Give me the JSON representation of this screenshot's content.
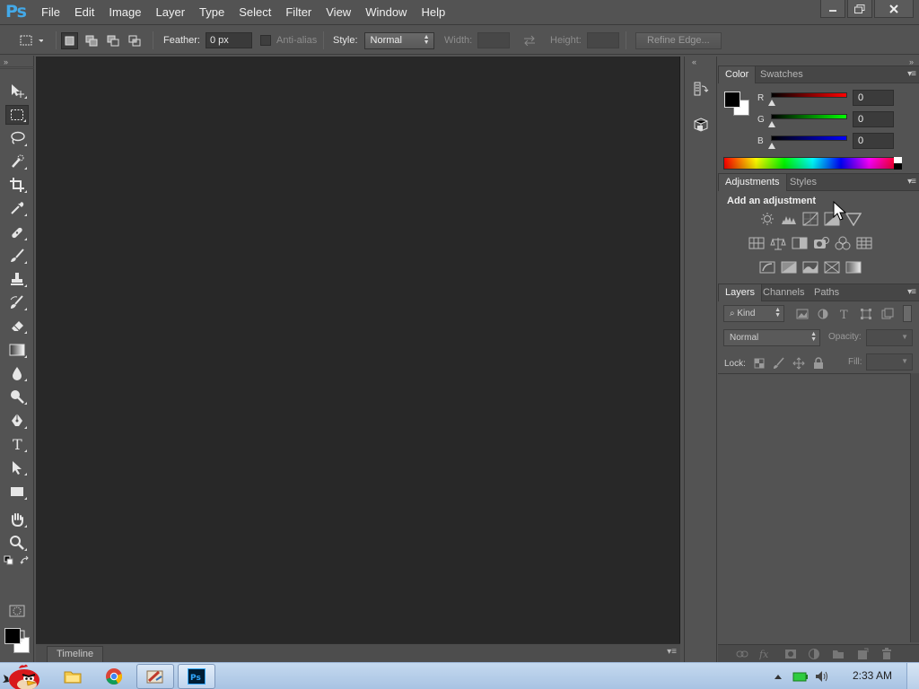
{
  "app": {
    "logo": "Ps"
  },
  "menu": [
    "File",
    "Edit",
    "Image",
    "Layer",
    "Type",
    "Select",
    "Filter",
    "View",
    "Window",
    "Help"
  ],
  "window_controls": {
    "minimize_icon": "minimize-icon",
    "restore_icon": "restore-icon",
    "close_icon": "close-icon"
  },
  "options": {
    "feather_label": "Feather:",
    "feather_value": "0 px",
    "antialias_label": "Anti-alias",
    "style_label": "Style:",
    "style_value": "Normal",
    "width_label": "Width:",
    "height_label": "Height:",
    "refine_edge_label": "Refine Edge..."
  },
  "tools": [
    "move-tool",
    "rectangular-marquee-tool",
    "lasso-tool",
    "quick-selection-tool",
    "crop-tool",
    "eyedropper-tool",
    "spot-healing-brush-tool",
    "brush-tool",
    "clone-stamp-tool",
    "history-brush-tool",
    "eraser-tool",
    "gradient-tool",
    "blur-tool",
    "dodge-tool",
    "pen-tool",
    "type-tool",
    "path-selection-tool",
    "rectangle-tool",
    "hand-tool",
    "zoom-tool"
  ],
  "colors": {
    "foreground": "#000000",
    "background": "#ffffff",
    "accent": "#43a9e8"
  },
  "timeline": {
    "tab_label": "Timeline"
  },
  "color_panel": {
    "tabs": [
      "Color",
      "Swatches"
    ],
    "r_label": "R",
    "r_value": "0",
    "g_label": "G",
    "g_value": "0",
    "b_label": "B",
    "b_value": "0"
  },
  "adjustments_panel": {
    "tabs": [
      "Adjustments",
      "Styles"
    ],
    "title": "Add an adjustment"
  },
  "layers_panel": {
    "tabs": [
      "Layers",
      "Channels",
      "Paths"
    ],
    "kind_label": "Kind",
    "blend_mode": "Normal",
    "opacity_label": "Opacity:",
    "lock_label": "Lock:",
    "fill_label": "Fill:"
  },
  "taskbar": {
    "time": "2:33 AM"
  }
}
